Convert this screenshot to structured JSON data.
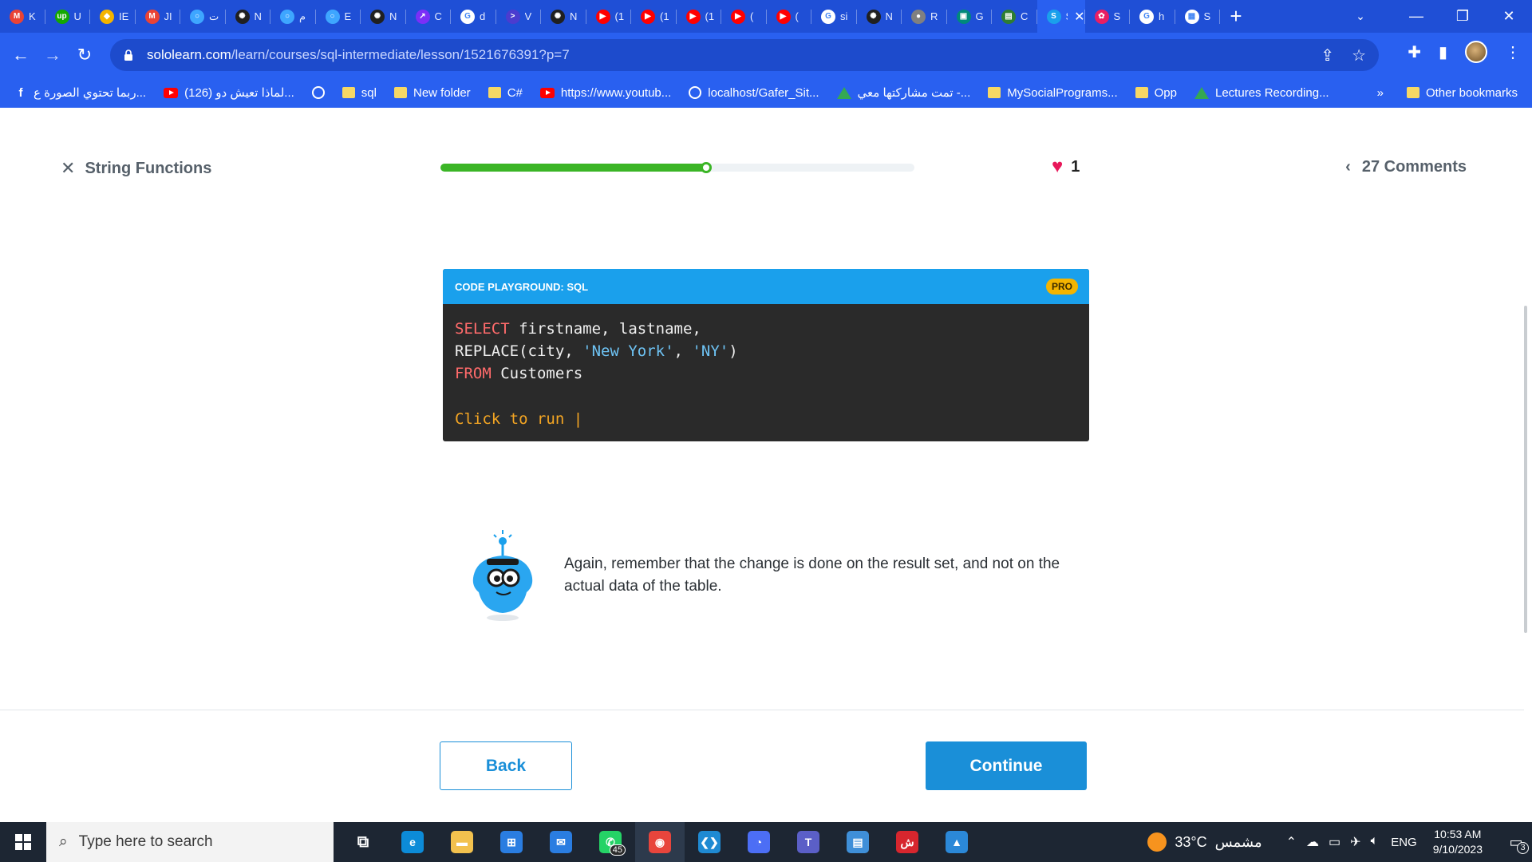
{
  "browser": {
    "tabs": [
      {
        "label": "K",
        "icon": "gmail-icon",
        "color": "#ea4335",
        "glyph": "M"
      },
      {
        "label": "U",
        "icon": "upwork-icon",
        "color": "#14a800",
        "glyph": "up"
      },
      {
        "label": "IE",
        "icon": "app-icon",
        "color": "#f4b400",
        "glyph": "◆"
      },
      {
        "label": "JI",
        "icon": "gmail-icon",
        "color": "#ea4335",
        "glyph": "M"
      },
      {
        "label": "ت",
        "icon": "circle-icon",
        "color": "#3ea6ff",
        "glyph": "○"
      },
      {
        "label": "N",
        "icon": "chatgpt-icon",
        "color": "#202020",
        "glyph": "✺"
      },
      {
        "label": "م",
        "icon": "circle-icon",
        "color": "#3ea6ff",
        "glyph": "○"
      },
      {
        "label": "E",
        "icon": "circle-icon",
        "color": "#3ea6ff",
        "glyph": "○"
      },
      {
        "label": "N",
        "icon": "chatgpt-icon",
        "color": "#202020",
        "glyph": "✺"
      },
      {
        "label": "C",
        "icon": "app-icon",
        "color": "#7b2ff7",
        "glyph": "↗"
      },
      {
        "label": "d",
        "icon": "google-icon",
        "color": "#ffffff",
        "glyph": "G"
      },
      {
        "label": "V",
        "icon": "terminal-icon",
        "color": "#4b3ccf",
        "glyph": ">"
      },
      {
        "label": "N",
        "icon": "chatgpt-icon",
        "color": "#202020",
        "glyph": "✺"
      },
      {
        "label": "(1",
        "icon": "youtube-icon",
        "color": "#ff0000",
        "glyph": "▶"
      },
      {
        "label": "(1",
        "icon": "youtube-icon",
        "color": "#ff0000",
        "glyph": "▶"
      },
      {
        "label": "(1",
        "icon": "youtube-icon",
        "color": "#ff0000",
        "glyph": "▶"
      },
      {
        "label": "(",
        "icon": "youtube-icon",
        "color": "#ff0000",
        "glyph": "▶"
      },
      {
        "label": "(",
        "icon": "youtube-icon",
        "color": "#ff0000",
        "glyph": "▶"
      },
      {
        "label": "si",
        "icon": "google-icon",
        "color": "#ffffff",
        "glyph": "G"
      },
      {
        "label": "N",
        "icon": "chatgpt-icon",
        "color": "#202020",
        "glyph": "✺"
      },
      {
        "label": "R",
        "icon": "globe-icon",
        "color": "#808080",
        "glyph": "●"
      },
      {
        "label": "G",
        "icon": "meet-icon",
        "color": "#00897b",
        "glyph": "▣"
      },
      {
        "label": "C",
        "icon": "app-icon",
        "color": "#2e7d32",
        "glyph": "▤"
      },
      {
        "label": "Sc",
        "icon": "sololearn-icon",
        "color": "#1aa0ec",
        "glyph": "S",
        "active": true
      },
      {
        "label": "S",
        "icon": "app-icon",
        "color": "#e91e63",
        "glyph": "✿"
      },
      {
        "label": "h",
        "icon": "google-icon",
        "color": "#ffffff",
        "glyph": "G"
      },
      {
        "label": "S",
        "icon": "app-icon",
        "color": "#ffffff",
        "glyph": "▦"
      }
    ],
    "new_tab": "+",
    "url_host": "sololearn.com",
    "url_path": "/learn/courses/sql-intermediate/lesson/1521676391?p=7",
    "bookmarks": [
      {
        "label": "ربما تحتوي الصورة ع...",
        "icon": "facebook-icon"
      },
      {
        "label": "(126) لماذا تعيش دو...",
        "icon": "youtube-icon"
      },
      {
        "label": "",
        "icon": "globe-icon"
      },
      {
        "label": "sql",
        "icon": "folder-icon"
      },
      {
        "label": "New folder",
        "icon": "folder-icon"
      },
      {
        "label": "C#",
        "icon": "folder-icon"
      },
      {
        "label": "https://www.youtub...",
        "icon": "youtube-icon"
      },
      {
        "label": "localhost/Gafer_Sit...",
        "icon": "globe-icon"
      },
      {
        "label": "تمت مشاركتها معي -...",
        "icon": "drive-icon"
      },
      {
        "label": "MySocialPrograms...",
        "icon": "folder-icon"
      },
      {
        "label": "Opp",
        "icon": "folder-icon"
      },
      {
        "label": "Lectures Recording...",
        "icon": "drive-icon"
      }
    ],
    "more_bookmarks": "»",
    "other_bookmarks": "Other bookmarks"
  },
  "lesson": {
    "title": "String Functions",
    "progress": 0.56,
    "hearts": "1",
    "comments": "27 Comments",
    "playground_title": "CODE PLAYGROUND: SQL",
    "pro_badge": "PRO",
    "code": {
      "line1_kw": "SELECT",
      "line1_rest": " firstname, lastname,",
      "line2_a": "REPLACE(city, ",
      "line2_s1": "'New York'",
      "line2_b": ", ",
      "line2_s2": "'NY'",
      "line2_c": ")",
      "line3_kw": "FROM",
      "line3_rest": " Customers"
    },
    "run_label": "Click to run |",
    "tip": "Again, remember that the change is done on the result set, and not on the actual data of the table.",
    "back_label": "Back",
    "continue_label": "Continue"
  },
  "taskbar": {
    "search_placeholder": "Type here to search",
    "apps": [
      {
        "name": "task-view-icon",
        "color": "transparent",
        "glyph": "⧉"
      },
      {
        "name": "edge-icon",
        "color": "#0c8bd8",
        "glyph": "e"
      },
      {
        "name": "file-explorer-icon",
        "color": "#f2c14e",
        "glyph": "▬"
      },
      {
        "name": "store-icon",
        "color": "#2a7de1",
        "glyph": "⊞"
      },
      {
        "name": "mail-icon",
        "color": "#2a7de1",
        "glyph": "✉"
      },
      {
        "name": "whatsapp-icon",
        "color": "#25d366",
        "glyph": "✆",
        "badge": "45"
      },
      {
        "name": "chrome-icon",
        "color": "#e8453c",
        "glyph": "◉",
        "active": true
      },
      {
        "name": "vscode-icon",
        "color": "#1f8ad2",
        "glyph": "❮❯"
      },
      {
        "name": "app-icon",
        "color": "#4c6ef5",
        "glyph": "◔"
      },
      {
        "name": "teams-icon",
        "color": "#5b5fc7",
        "glyph": "T"
      },
      {
        "name": "contacts-icon",
        "color": "#3f8fd8",
        "glyph": "▤"
      },
      {
        "name": "app-icon",
        "color": "#d7262e",
        "glyph": "ش"
      },
      {
        "name": "photos-icon",
        "color": "#2b88d8",
        "glyph": "▲"
      }
    ],
    "weather_temp": "33°C",
    "weather_desc": "مشمس",
    "language": "ENG",
    "time": "10:53 AM",
    "date": "9/10/2023",
    "notifications": "3"
  }
}
